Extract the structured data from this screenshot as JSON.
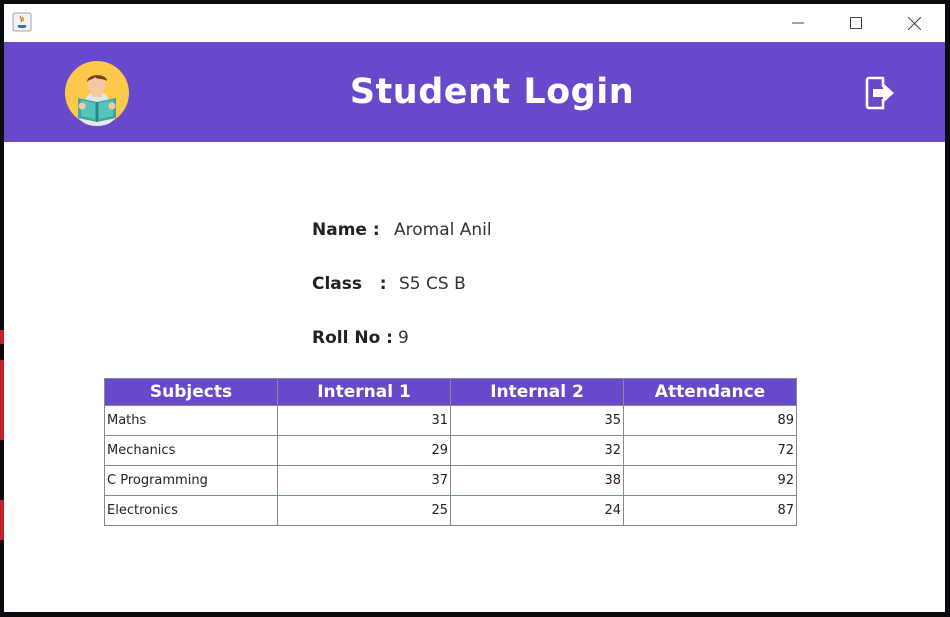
{
  "window": {
    "title": "",
    "controls": [
      "minimize-icon",
      "maximize-icon",
      "close-icon"
    ]
  },
  "header": {
    "title": "Student Login",
    "background_color": "#6849cc",
    "avatar_icon": "student-reading-avatar-icon",
    "logout_icon": "logout-icon"
  },
  "student": {
    "name_label": "Name :",
    "name_value": "Aromal Anil",
    "class_label": "Class   :",
    "class_value": "S5 CS B",
    "roll_label": "Roll No :",
    "roll_value": "9"
  },
  "table": {
    "columns": [
      "Subjects",
      "Internal 1",
      "Internal 2",
      "Attendance"
    ],
    "rows": [
      [
        "Maths",
        "31",
        "35",
        "89"
      ],
      [
        "Mechanics",
        "29",
        "32",
        "72"
      ],
      [
        "C Programming",
        "37",
        "38",
        "92"
      ],
      [
        "Electronics",
        "25",
        "24",
        "87"
      ]
    ]
  }
}
